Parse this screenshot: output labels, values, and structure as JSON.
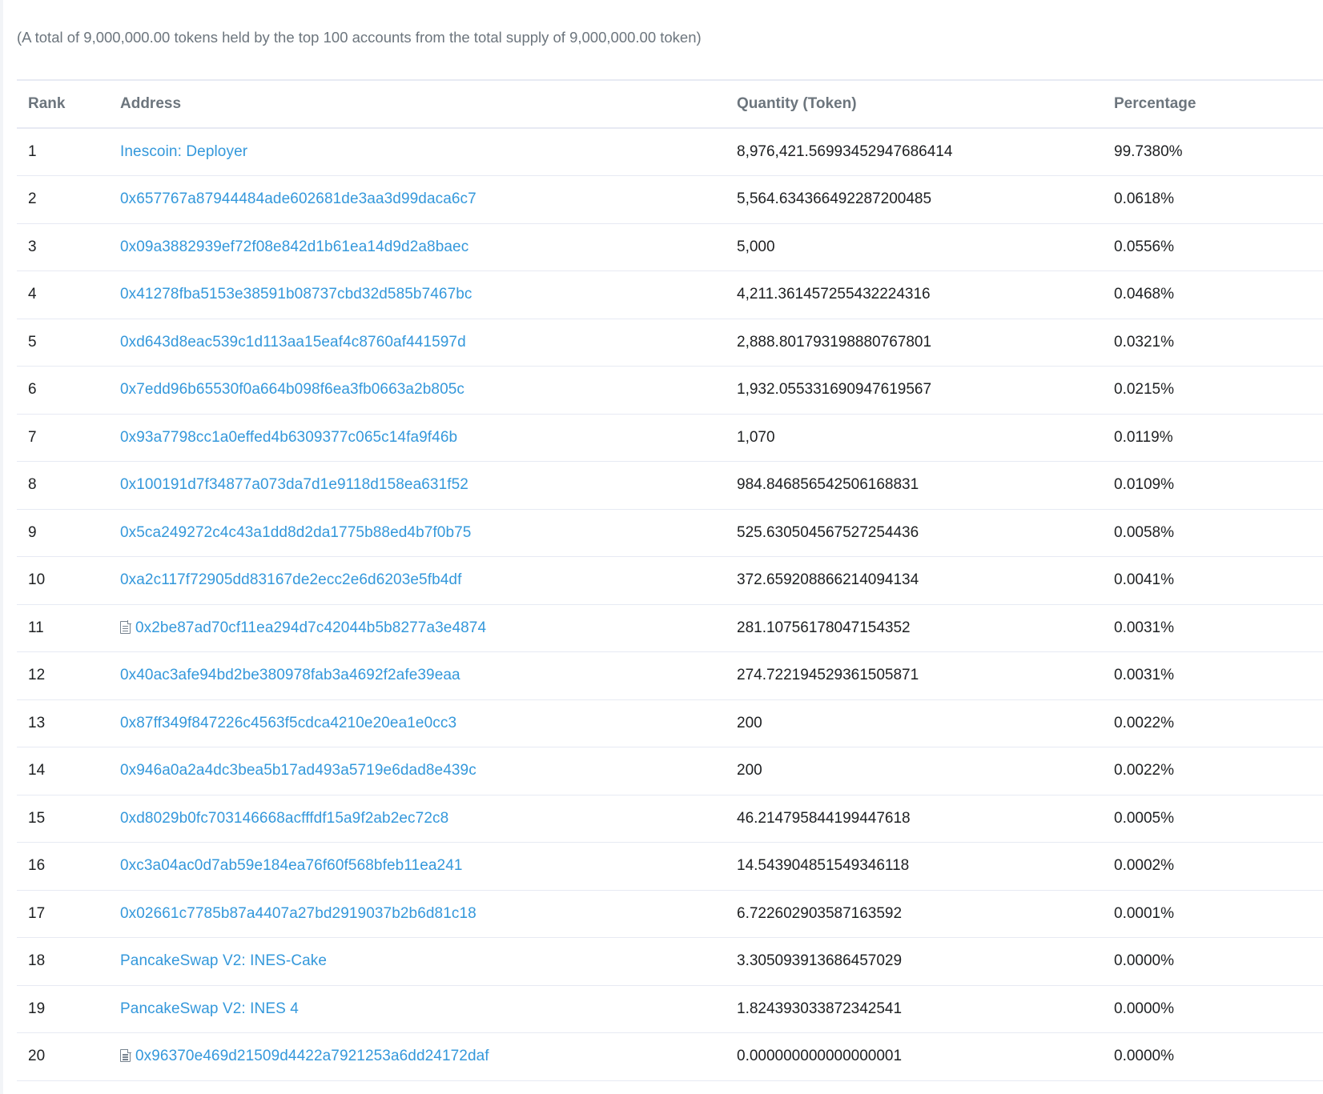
{
  "summary_text": "(A total of 9,000,000.00 tokens held by the top 100 accounts from the total supply of 9,000,000.00 token)",
  "table": {
    "headers": {
      "rank": "Rank",
      "address": "Address",
      "quantity": "Quantity (Token)",
      "percentage": "Percentage"
    },
    "rows": [
      {
        "rank": "1",
        "address": "Inescoin: Deployer",
        "is_contract": false,
        "quantity": "8,976,421.56993452947686414",
        "percentage": "99.7380%"
      },
      {
        "rank": "2",
        "address": "0x657767a87944484ade602681de3aa3d99daca6c7",
        "is_contract": false,
        "quantity": "5,564.634366492287200485",
        "percentage": "0.0618%"
      },
      {
        "rank": "3",
        "address": "0x09a3882939ef72f08e842d1b61ea14d9d2a8baec",
        "is_contract": false,
        "quantity": "5,000",
        "percentage": "0.0556%"
      },
      {
        "rank": "4",
        "address": "0x41278fba5153e38591b08737cbd32d585b7467bc",
        "is_contract": false,
        "quantity": "4,211.361457255432224316",
        "percentage": "0.0468%"
      },
      {
        "rank": "5",
        "address": "0xd643d8eac539c1d113aa15eaf4c8760af441597d",
        "is_contract": false,
        "quantity": "2,888.801793198880767801",
        "percentage": "0.0321%"
      },
      {
        "rank": "6",
        "address": "0x7edd96b65530f0a664b098f6ea3fb0663a2b805c",
        "is_contract": false,
        "quantity": "1,932.055331690947619567",
        "percentage": "0.0215%"
      },
      {
        "rank": "7",
        "address": "0x93a7798cc1a0effed4b6309377c065c14fa9f46b",
        "is_contract": false,
        "quantity": "1,070",
        "percentage": "0.0119%"
      },
      {
        "rank": "8",
        "address": "0x100191d7f34877a073da7d1e9118d158ea631f52",
        "is_contract": false,
        "quantity": "984.846856542506168831",
        "percentage": "0.0109%"
      },
      {
        "rank": "9",
        "address": "0x5ca249272c4c43a1dd8d2da1775b88ed4b7f0b75",
        "is_contract": false,
        "quantity": "525.630504567527254436",
        "percentage": "0.0058%"
      },
      {
        "rank": "10",
        "address": "0xa2c117f72905dd83167de2ecc2e6d6203e5fb4df",
        "is_contract": false,
        "quantity": "372.659208866214094134",
        "percentage": "0.0041%"
      },
      {
        "rank": "11",
        "address": "0x2be87ad70cf11ea294d7c42044b5b8277a3e4874",
        "is_contract": true,
        "quantity": "281.10756178047154352",
        "percentage": "0.0031%"
      },
      {
        "rank": "12",
        "address": "0x40ac3afe94bd2be380978fab3a4692f2afe39eaa",
        "is_contract": false,
        "quantity": "274.722194529361505871",
        "percentage": "0.0031%"
      },
      {
        "rank": "13",
        "address": "0x87ff349f847226c4563f5cdca4210e20ea1e0cc3",
        "is_contract": false,
        "quantity": "200",
        "percentage": "0.0022%"
      },
      {
        "rank": "14",
        "address": "0x946a0a2a4dc3bea5b17ad493a5719e6dad8e439c",
        "is_contract": false,
        "quantity": "200",
        "percentage": "0.0022%"
      },
      {
        "rank": "15",
        "address": "0xd8029b0fc703146668acfffdf15a9f2ab2ec72c8",
        "is_contract": false,
        "quantity": "46.214795844199447618",
        "percentage": "0.0005%"
      },
      {
        "rank": "16",
        "address": "0xc3a04ac0d7ab59e184ea76f60f568bfeb11ea241",
        "is_contract": false,
        "quantity": "14.543904851549346118",
        "percentage": "0.0002%"
      },
      {
        "rank": "17",
        "address": "0x02661c7785b87a4407a27bd2919037b2b6d81c18",
        "is_contract": false,
        "quantity": "6.722602903587163592",
        "percentage": "0.0001%"
      },
      {
        "rank": "18",
        "address": "PancakeSwap V2: INES-Cake",
        "is_contract": false,
        "quantity": "3.305093913686457029",
        "percentage": "0.0000%"
      },
      {
        "rank": "19",
        "address": "PancakeSwap V2: INES 4",
        "is_contract": false,
        "quantity": "1.824393033872342541",
        "percentage": "0.0000%"
      },
      {
        "rank": "20",
        "address": "0x96370e469d21509d4422a7921253a6dd24172daf",
        "is_contract": true,
        "quantity": "0.000000000000000001",
        "percentage": "0.0000%"
      }
    ]
  },
  "icons": {
    "contract": "file-text-icon"
  },
  "colors": {
    "link": "#3498db",
    "header_text": "#6c757d",
    "border": "#e7eaf3"
  }
}
